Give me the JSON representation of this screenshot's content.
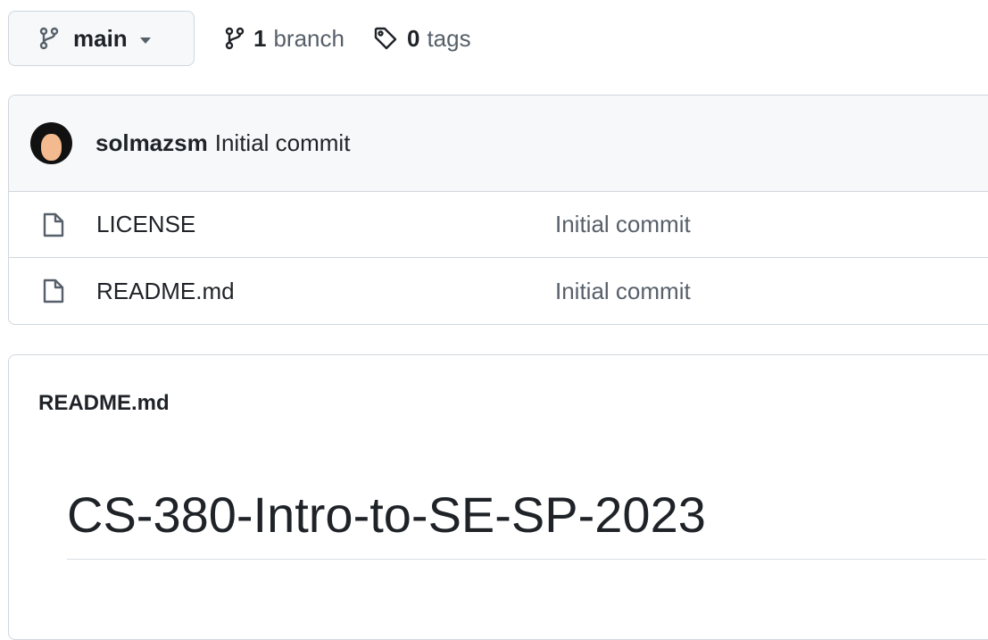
{
  "branch_selector": {
    "current_branch": "main"
  },
  "repo_meta": {
    "branches_count": "1",
    "branches_label": "branch",
    "tags_count": "0",
    "tags_label": "tags"
  },
  "latest_commit": {
    "author": "solmazsm",
    "message": "Initial commit"
  },
  "files": [
    {
      "name": "LICENSE",
      "commit_message": "Initial commit",
      "icon": "file-icon"
    },
    {
      "name": "README.md",
      "commit_message": "Initial commit",
      "icon": "file-icon"
    }
  ],
  "readme": {
    "filename": "README.md",
    "title": "CS-380-Intro-to-SE-SP-2023"
  },
  "colors": {
    "border": "#d0d7de",
    "header_bg": "#f6f8fa",
    "muted_text": "#57606a",
    "text": "#1f2328"
  }
}
